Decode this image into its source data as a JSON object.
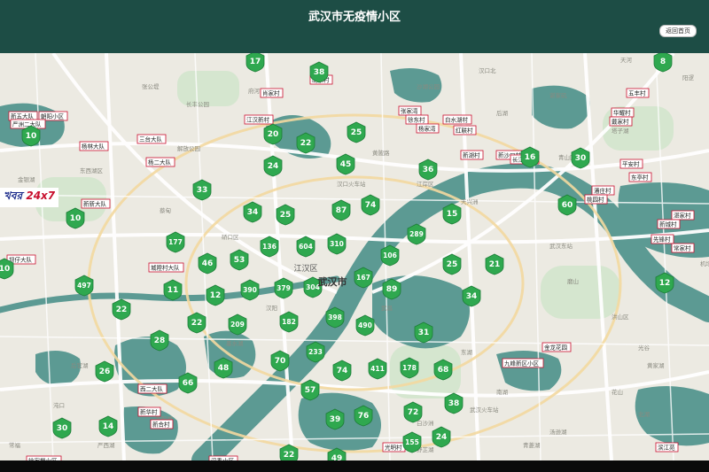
{
  "header": {
    "title": "武汉市无疫情小区",
    "home_button": "返回首页"
  },
  "watermark": {
    "text_a": "খবর",
    "text_b": " 24x7"
  },
  "map": {
    "district_label": "江汉区",
    "city_label": "武汉市",
    "map_labels": [
      "长丰公园",
      "汉口火车站",
      "黄陂路",
      "解放公园",
      "沙湖公园",
      "东湖",
      "天兴洲",
      "武汉东站",
      "南湖",
      "墨水湖",
      "龙阳湖",
      "后官湖",
      "汤逊湖",
      "野芷湖",
      "汉阳",
      "武昌",
      "青山区",
      "洪山区",
      "东西湖区",
      "硚口区",
      "江岸区",
      "武汉火车站",
      "光谷",
      "白沙洲",
      "花山",
      "严西湖",
      "北湖",
      "青菱湖",
      "黄家湖",
      "磨山",
      "沌口",
      "常福",
      "蔡甸",
      "金银湖",
      "府河",
      "张公堤",
      "后湖",
      "塔子湖",
      "汉口北",
      "谌家矶",
      "阳逻",
      "天河",
      "机场"
    ],
    "badges": [
      {
        "n": "17"
      },
      {
        "n": "38"
      },
      {
        "n": "20"
      },
      {
        "n": "22"
      },
      {
        "n": "25"
      },
      {
        "n": "24"
      },
      {
        "n": "45"
      },
      {
        "n": "33"
      },
      {
        "n": "34"
      },
      {
        "n": "25"
      },
      {
        "n": "87"
      },
      {
        "n": "74"
      },
      {
        "n": "15"
      },
      {
        "n": "36"
      },
      {
        "n": "177"
      },
      {
        "n": "136"
      },
      {
        "n": "604"
      },
      {
        "n": "310"
      },
      {
        "n": "289"
      },
      {
        "n": "46"
      },
      {
        "n": "53"
      },
      {
        "n": "106"
      },
      {
        "n": "25"
      },
      {
        "n": "21"
      },
      {
        "n": "11"
      },
      {
        "n": "12"
      },
      {
        "n": "390"
      },
      {
        "n": "379"
      },
      {
        "n": "304"
      },
      {
        "n": "167"
      },
      {
        "n": "89"
      },
      {
        "n": "34"
      },
      {
        "n": "22"
      },
      {
        "n": "22"
      },
      {
        "n": "209"
      },
      {
        "n": "182"
      },
      {
        "n": "398"
      },
      {
        "n": "490"
      },
      {
        "n": "31"
      },
      {
        "n": "28"
      },
      {
        "n": "70"
      },
      {
        "n": "233"
      },
      {
        "n": "26"
      },
      {
        "n": "48"
      },
      {
        "n": "74"
      },
      {
        "n": "411"
      },
      {
        "n": "178"
      },
      {
        "n": "68"
      },
      {
        "n": "66"
      },
      {
        "n": "57"
      },
      {
        "n": "72"
      },
      {
        "n": "38"
      },
      {
        "n": "39"
      },
      {
        "n": "76"
      },
      {
        "n": "155"
      },
      {
        "n": "24"
      },
      {
        "n": "30"
      },
      {
        "n": "14"
      },
      {
        "n": "22"
      },
      {
        "n": "49"
      },
      {
        "n": "30"
      },
      {
        "n": "60"
      },
      {
        "n": "16"
      },
      {
        "n": "12"
      },
      {
        "n": "10"
      },
      {
        "n": "10"
      },
      {
        "n": "497"
      },
      {
        "n": "10"
      },
      {
        "n": "8"
      }
    ],
    "place_tags": [
      {
        "t": "胡家村"
      },
      {
        "t": "肖家村"
      },
      {
        "t": "江汉新村"
      },
      {
        "t": "白水湖村"
      },
      {
        "t": "红联村"
      },
      {
        "t": "五丰村"
      },
      {
        "t": "华耀村"
      },
      {
        "t": "戴家村"
      },
      {
        "t": "平安村"
      },
      {
        "t": "潘庄村"
      },
      {
        "t": "桃园村"
      },
      {
        "t": "新五大队"
      },
      {
        "t": "朝阳小区"
      },
      {
        "t": "三台大队"
      },
      {
        "t": "杨林大队"
      },
      {
        "t": "严洲二大队"
      },
      {
        "t": "杨二大队"
      },
      {
        "t": "新新大队"
      },
      {
        "t": "坝仔大队"
      },
      {
        "t": "城隍村大队"
      },
      {
        "t": "湛家村"
      },
      {
        "t": "西二大队"
      },
      {
        "t": "新华村"
      },
      {
        "t": "新合村"
      },
      {
        "t": "金龙花园"
      },
      {
        "t": "新沙口村"
      },
      {
        "t": "长江新城"
      },
      {
        "t": "九峰新区小区"
      },
      {
        "t": "滨江苑"
      },
      {
        "t": "张家湾"
      },
      {
        "t": "徐东村"
      },
      {
        "t": "杨家湾"
      },
      {
        "t": "新湖村"
      },
      {
        "t": "东亭村"
      },
      {
        "t": "先锋村"
      },
      {
        "t": "常家村"
      },
      {
        "t": "汉秀小区"
      },
      {
        "t": "徐家棚小区"
      },
      {
        "t": "光明村"
      },
      {
        "t": "新城村"
      }
    ]
  }
}
